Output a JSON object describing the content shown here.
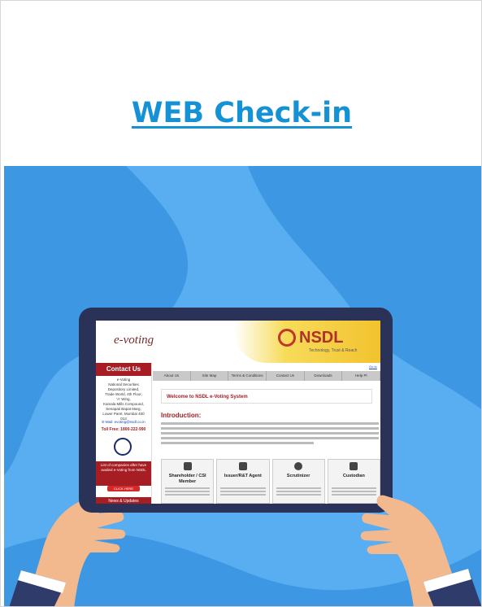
{
  "heading": {
    "title": "WEB Check-in"
  },
  "screen": {
    "logo_left": "e-voting",
    "logo_right": "NSDL",
    "logo_tagline": "Technology, Trust & Reach",
    "contact_title": "Contact Us",
    "contact_lines": [
      "e-Voting",
      "National Securities",
      "Depository Limited,",
      "Trade World, 4th Floor,",
      "'A' Wing,",
      "Kamala Mills Compound,",
      "Senapati Bapat Marg,",
      "Lower Parel, Mumbai 400 013"
    ],
    "email_line": "E-Mail: evoting@nsdl.co.in",
    "toll_free": "Toll Free: 1800-222-990",
    "company_box": "List of companies after have availed e-Voting from NSDL",
    "click_here": "CLICK HERE",
    "news": "News & Updates",
    "go_link": "Go to",
    "nav": [
      "About Us",
      "Site Map",
      "Terms & Conditions",
      "Contact Us",
      "Downloads",
      "Help Pl"
    ],
    "welcome": "Welcome to NSDL e-Voting System",
    "intro": "Introduction:",
    "cards": [
      {
        "label": "Shareholder / CSI Member",
        "icon": "shareholder-icon"
      },
      {
        "label": "Issuer/R&T Agent",
        "icon": "issuer-icon"
      },
      {
        "label": "Scrutinizer",
        "icon": "magnifier-icon"
      },
      {
        "label": "Custodian",
        "icon": "custodian-icon"
      }
    ]
  },
  "colors": {
    "accent": "#1592d6",
    "hero_bg": "#58aef0",
    "brand_red": "#a61d23"
  }
}
